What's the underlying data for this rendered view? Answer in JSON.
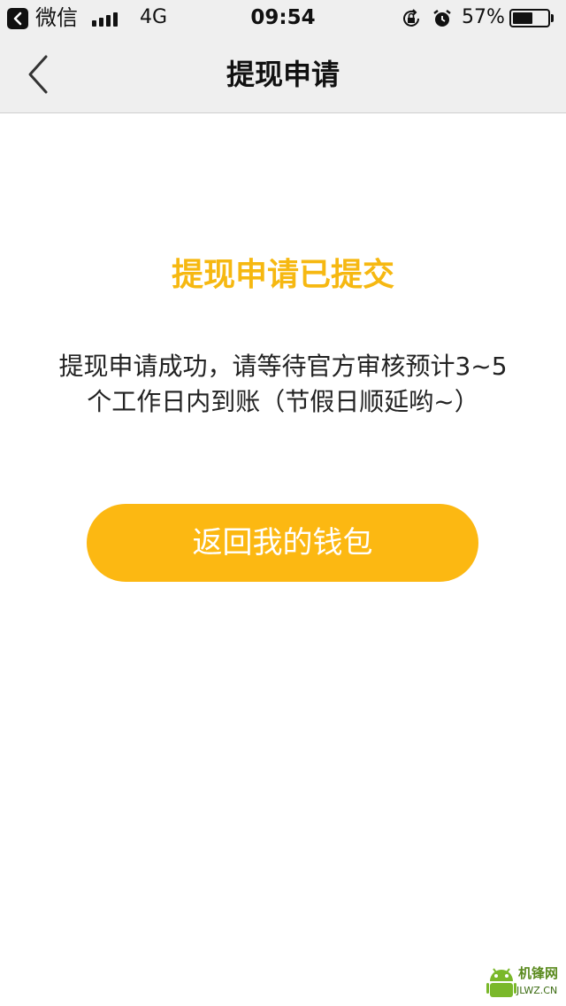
{
  "status_bar": {
    "app_name": "微信",
    "network": "4G",
    "time": "09:54",
    "battery_percent": "57%",
    "battery_level": 0.57,
    "signal_bars": 4
  },
  "nav": {
    "title": "提现申请"
  },
  "content": {
    "success_title": "提现申请已提交",
    "message": "提现申请成功，请等待官方审核预计3~5个工作日内到账（节假日顺延哟~）",
    "return_button_label": "返回我的钱包"
  },
  "watermark": {
    "text": "机锋网",
    "url": "JLWZ.CN"
  },
  "colors": {
    "accent": "#f6b811",
    "button": "#fcb812",
    "bar_bg": "#efefef"
  },
  "icons": {
    "back": "chevron-left-icon",
    "status_back": "back-to-app-icon",
    "lock": "rotation-lock-icon",
    "alarm": "alarm-icon",
    "battery": "battery-icon",
    "signal": "signal-icon"
  }
}
